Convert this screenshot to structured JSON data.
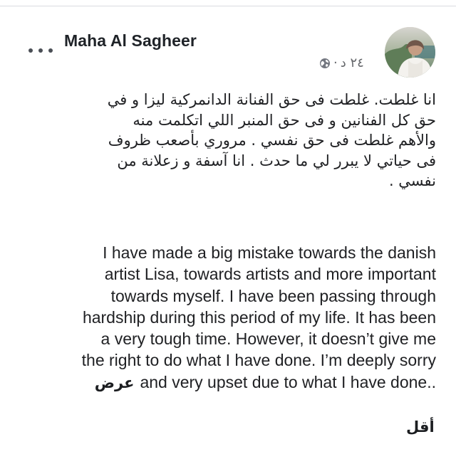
{
  "post": {
    "author": "Maha Al Sagheer",
    "time": "٢٤ د",
    "separator": "·",
    "privacy_icon": "globe-icon",
    "more_icon": "more-options-icon",
    "arabic_lines": [
      "انا غلطت. غلطت فى حق الفنانة الدانمركية ليزا و في",
      "حق كل الفنانين و فى حق المنبر اللي اتكلمت منه",
      "والأهم غلطت فى حق نفسي . مروري بأصعب ظروف",
      "فى حياتي لا يبرر لي ما حدث . انا آسفة و زعلانة من",
      "نفسي ."
    ],
    "english_lines": [
      "I have made a big mistake towards the danish",
      "artist Lisa, towards artists and more important",
      "towards myself. I have been passing through",
      "hardship during this period of my life. It has been",
      "a very tough time. However, it doesn’t give me",
      "the right to do what I have done. I’m deeply sorry",
      "and very upset due to what I have done.."
    ],
    "see_more": "عرض",
    "see_less": "أقل"
  },
  "colors": {
    "text": "#202124",
    "meta": "#65676b",
    "border": "#d9dbe0"
  }
}
